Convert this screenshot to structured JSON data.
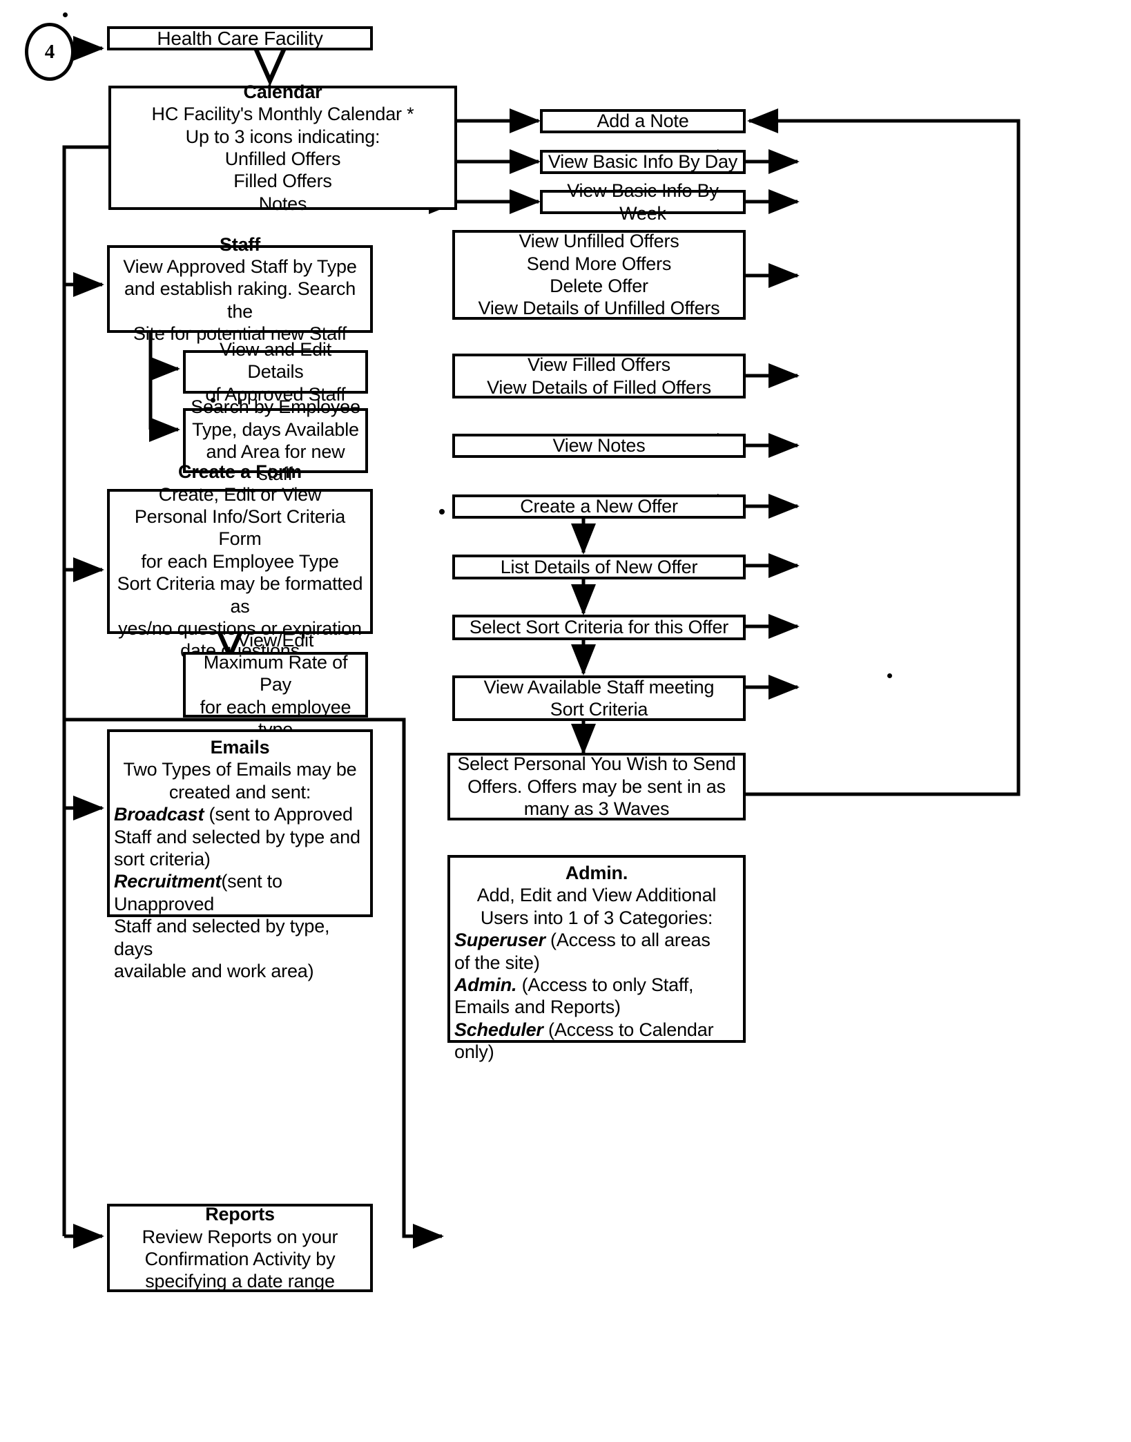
{
  "figure": {
    "marker_label": "4",
    "type": "flowchart"
  },
  "nodes": {
    "health_care_facility": {
      "title": "Health Care Facility"
    },
    "calendar": {
      "title": "Calendar",
      "lines": [
        "HC Facility's Monthly Calendar *",
        "Up to 3 icons indicating:",
        "Unfilled Offers",
        "Filled Offers",
        "Notes"
      ]
    },
    "add_a_note": {
      "title": "Add a Note"
    },
    "view_basic_info_by_day": {
      "title": "View Basic Info By Day"
    },
    "view_basic_info_by_week": {
      "title": "View Basic Info By Week"
    },
    "staff": {
      "title": "Staff",
      "lines": [
        "View Approved Staff by Type",
        "and establish raking. Search the",
        "Site for potential new Staff"
      ]
    },
    "unfilled_offers_group": {
      "lines": [
        "View Unfilled Offers",
        "Send More Offers",
        "Delete Offer",
        "View Details of Unfilled Offers"
      ]
    },
    "view_edit_approved_staff": {
      "lines": [
        "View and Edit Details",
        "of Approved Staff"
      ]
    },
    "filled_offers_group": {
      "lines": [
        "View Filled Offers",
        "View Details of Filled Offers"
      ]
    },
    "search_by_employee": {
      "lines": [
        "Search by Employee",
        "Type, days Available",
        "and Area for new staff"
      ]
    },
    "view_notes": {
      "title": "View Notes"
    },
    "create_a_form": {
      "title": "Create a Form",
      "lines": [
        "Create, Edit or View",
        "Personal Info/Sort Criteria Form",
        "for each Employee Type",
        "Sort Criteria may be formatted as",
        "yes/no questions or expiration",
        "date questions"
      ]
    },
    "create_a_new_offer": {
      "title": "Create a New Offer"
    },
    "list_details_of_new_offer": {
      "title": "List Details of New Offer"
    },
    "select_sort_criteria": {
      "title": "Select Sort Criteria for this Offer"
    },
    "view_edit_max_rate": {
      "lines": [
        "View/Edit",
        "Maximum Rate of Pay",
        "for each employee type"
      ]
    },
    "view_available_staff": {
      "lines": [
        "View Available Staff meeting",
        "Sort Criteria"
      ]
    },
    "emails": {
      "title": "Emails",
      "lines": [
        "Two Types of Emails may be",
        "created and sent:"
      ],
      "broadcast_label": "Broadcast",
      "broadcast_text": " (sent to Approved",
      "broadcast_cont": [
        "Staff and selected by type and",
        "sort criteria)"
      ],
      "recruitment_label": "Recruitment",
      "recruitment_text": "(sent to Unapproved",
      "recruitment_cont": [
        "Staff and selected by type, days",
        "available and work area)"
      ]
    },
    "select_personal": {
      "lines": [
        "Select Personal You Wish to Send",
        "Offers.  Offers may be sent in as",
        "many as 3 Waves"
      ]
    },
    "reports": {
      "title": "Reports",
      "lines": [
        "Review Reports on your",
        "Confirmation Activity by",
        "specifying a date range"
      ]
    },
    "admin": {
      "title": "Admin.",
      "lines": [
        "Add, Edit and View Additional",
        "Users into 1 of 3 Categories:"
      ],
      "superuser_label": "Superuser",
      "superuser_text": " (Access to all areas",
      "superuser_cont": "of the site)",
      "admin_label": "Admin.",
      "admin_text": " (Access to only Staff,",
      "admin_cont": "Emails and Reports)",
      "scheduler_label": "Scheduler",
      "scheduler_text": " (Access to Calendar",
      "scheduler_cont": "only)"
    }
  },
  "colors": {
    "ink": "#000000",
    "paper": "#ffffff"
  }
}
